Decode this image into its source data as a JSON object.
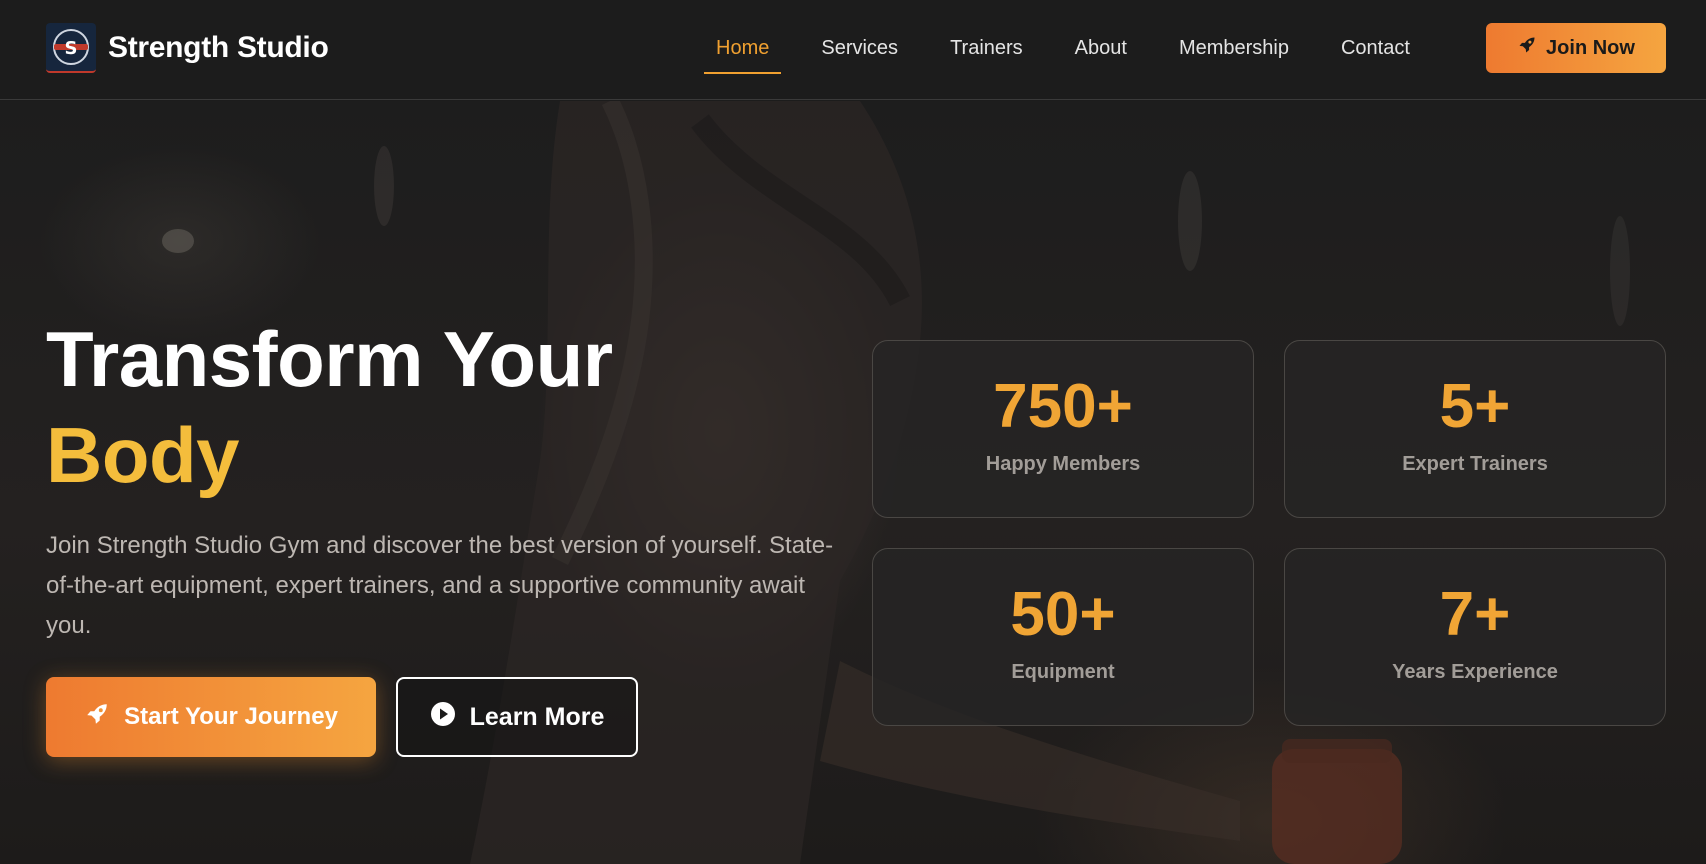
{
  "brand": {
    "name": "Strength Studio",
    "logo_icon": "dumbbell-shield-icon"
  },
  "nav": {
    "items": [
      {
        "label": "Home",
        "active": true
      },
      {
        "label": "Services",
        "active": false
      },
      {
        "label": "Trainers",
        "active": false
      },
      {
        "label": "About",
        "active": false
      },
      {
        "label": "Membership",
        "active": false
      },
      {
        "label": "Contact",
        "active": false
      }
    ],
    "cta": {
      "label": "Join Now",
      "icon": "rocket-icon"
    }
  },
  "hero": {
    "title_line1": "Transform Your",
    "title_line2": "Body",
    "description": "Join Strength Studio Gym and discover the best version of yourself. State-of-the-art equipment, expert trainers, and a supportive community await you.",
    "primary_button": {
      "label": "Start Your Journey",
      "icon": "rocket-icon"
    },
    "secondary_button": {
      "label": "Learn More",
      "icon": "play-circle-icon"
    }
  },
  "stats": [
    {
      "value": "750+",
      "label": "Happy Members"
    },
    {
      "value": "5+",
      "label": "Expert Trainers"
    },
    {
      "value": "50+",
      "label": "Equipment"
    },
    {
      "value": "7+",
      "label": "Years Experience"
    }
  ],
  "colors": {
    "accent": "#f0a030",
    "accent_gradient_start": "#ee7a30",
    "accent_gradient_end": "#f5a540",
    "title_highlight": "#f4bd3c",
    "background": "#1c1c1c"
  }
}
